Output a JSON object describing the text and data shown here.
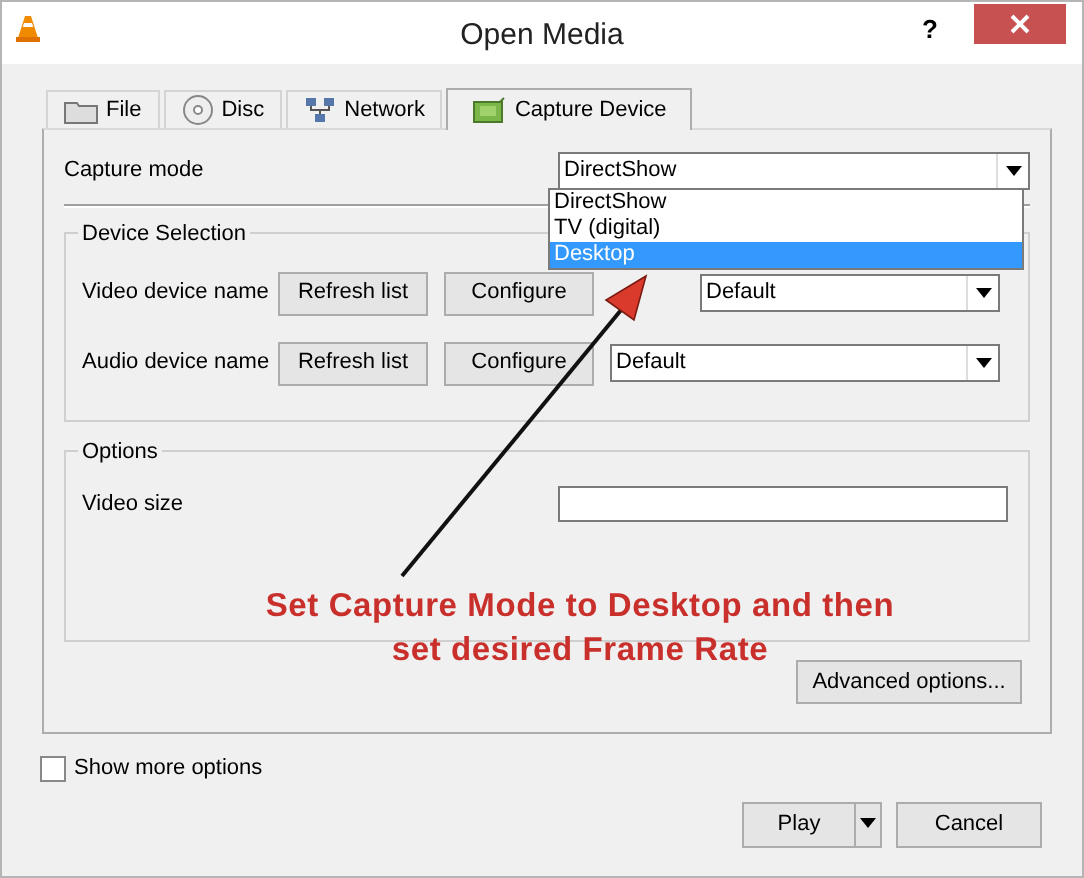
{
  "window": {
    "title": "Open Media",
    "help": "?"
  },
  "tabs": [
    {
      "kind": "file",
      "label": "File",
      "selected": false
    },
    {
      "kind": "disc",
      "label": "Disc",
      "selected": false
    },
    {
      "kind": "network",
      "label": "Network",
      "selected": false
    },
    {
      "kind": "capture",
      "label": "Capture Device",
      "selected": true
    }
  ],
  "capture_mode": {
    "label": "Capture mode",
    "value": "DirectShow",
    "expanded": true,
    "options": [
      {
        "label": "DirectShow",
        "highlighted": false
      },
      {
        "label": "TV (digital)",
        "highlighted": false
      },
      {
        "label": "Desktop",
        "highlighted": true
      }
    ]
  },
  "device_selection": {
    "title": "Device Selection",
    "rows": [
      {
        "label": "Video device name",
        "refresh": "Refresh list",
        "configure": "Configure",
        "value": "Default"
      },
      {
        "label": "Audio device name",
        "refresh": "Refresh list",
        "configure": "Configure",
        "value": "Default"
      }
    ]
  },
  "options": {
    "title": "Options",
    "fields": [
      {
        "label": "Video size"
      }
    ]
  },
  "advanced_button": "Advanced options...",
  "show_more_options": {
    "label": "Show more options",
    "checked": false
  },
  "footer": {
    "play": "Play",
    "cancel": "Cancel"
  },
  "annotation": {
    "text": "Set Capture Mode to Desktop and then set desired Frame Rate"
  }
}
